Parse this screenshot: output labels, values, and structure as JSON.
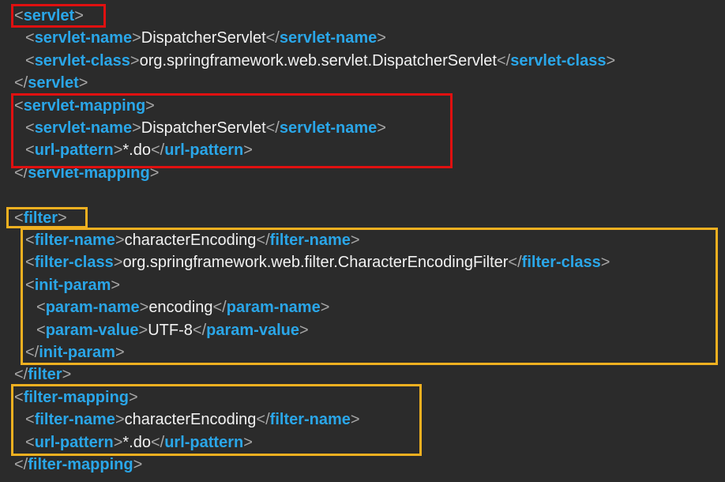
{
  "editor": {
    "colors": {
      "background": "#2b2b2b",
      "tag": "#2aa6e8",
      "bracket": "#a8a8a8",
      "text": "#f2f2f2",
      "highlight_red": "#e01010",
      "highlight_orange": "#f0b020"
    },
    "lines": [
      {
        "indent": 0,
        "tokens": [
          {
            "t": "b",
            "v": "<"
          },
          {
            "t": "g",
            "v": "servlet"
          },
          {
            "t": "b",
            "v": ">"
          }
        ]
      },
      {
        "indent": 1,
        "tokens": [
          {
            "t": "b",
            "v": "<"
          },
          {
            "t": "g",
            "v": "servlet-name"
          },
          {
            "t": "b",
            "v": ">"
          },
          {
            "t": "x",
            "v": "DispatcherServlet"
          },
          {
            "t": "b",
            "v": "</"
          },
          {
            "t": "g",
            "v": "servlet-name"
          },
          {
            "t": "b",
            "v": ">"
          }
        ]
      },
      {
        "indent": 1,
        "tokens": [
          {
            "t": "b",
            "v": "<"
          },
          {
            "t": "g",
            "v": "servlet-class"
          },
          {
            "t": "b",
            "v": ">"
          },
          {
            "t": "x",
            "v": "org.springframework.web.servlet.DispatcherServlet"
          },
          {
            "t": "b",
            "v": "</"
          },
          {
            "t": "g",
            "v": "servlet-class"
          },
          {
            "t": "b",
            "v": ">"
          }
        ]
      },
      {
        "indent": 0,
        "tokens": [
          {
            "t": "b",
            "v": "</"
          },
          {
            "t": "g",
            "v": "servlet"
          },
          {
            "t": "b",
            "v": ">"
          }
        ]
      },
      {
        "indent": 0,
        "tokens": [
          {
            "t": "b",
            "v": "<"
          },
          {
            "t": "g",
            "v": "servlet-mapping"
          },
          {
            "t": "b",
            "v": ">"
          }
        ]
      },
      {
        "indent": 1,
        "tokens": [
          {
            "t": "b",
            "v": "<"
          },
          {
            "t": "g",
            "v": "servlet-name"
          },
          {
            "t": "b",
            "v": ">"
          },
          {
            "t": "x",
            "v": "DispatcherServlet"
          },
          {
            "t": "b",
            "v": "</"
          },
          {
            "t": "g",
            "v": "servlet-name"
          },
          {
            "t": "b",
            "v": ">"
          }
        ]
      },
      {
        "indent": 1,
        "tokens": [
          {
            "t": "b",
            "v": "<"
          },
          {
            "t": "g",
            "v": "url-pattern"
          },
          {
            "t": "b",
            "v": ">"
          },
          {
            "t": "x",
            "v": "*.do"
          },
          {
            "t": "b",
            "v": "</"
          },
          {
            "t": "g",
            "v": "url-pattern"
          },
          {
            "t": "b",
            "v": ">"
          }
        ]
      },
      {
        "indent": 0,
        "tokens": [
          {
            "t": "b",
            "v": "</"
          },
          {
            "t": "g",
            "v": "servlet-mapping"
          },
          {
            "t": "b",
            "v": ">"
          }
        ]
      },
      {
        "indent": 0,
        "tokens": []
      },
      {
        "indent": 0,
        "tokens": [
          {
            "t": "b",
            "v": "<"
          },
          {
            "t": "g",
            "v": "filter"
          },
          {
            "t": "b",
            "v": ">"
          }
        ]
      },
      {
        "indent": 1,
        "tokens": [
          {
            "t": "b",
            "v": "<"
          },
          {
            "t": "g",
            "v": "filter-name"
          },
          {
            "t": "b",
            "v": ">"
          },
          {
            "t": "x",
            "v": "characterEncoding"
          },
          {
            "t": "b",
            "v": "</"
          },
          {
            "t": "g",
            "v": "filter-name"
          },
          {
            "t": "b",
            "v": ">"
          }
        ]
      },
      {
        "indent": 1,
        "tokens": [
          {
            "t": "b",
            "v": "<"
          },
          {
            "t": "g",
            "v": "filter-class"
          },
          {
            "t": "b",
            "v": ">"
          },
          {
            "t": "x",
            "v": "org.springframework.web.filter.CharacterEncodingFilter"
          },
          {
            "t": "b",
            "v": "</"
          },
          {
            "t": "g",
            "v": "filter-class"
          },
          {
            "t": "b",
            "v": ">"
          }
        ]
      },
      {
        "indent": 1,
        "tokens": [
          {
            "t": "b",
            "v": "<"
          },
          {
            "t": "g",
            "v": "init-param"
          },
          {
            "t": "b",
            "v": ">"
          }
        ]
      },
      {
        "indent": 2,
        "tokens": [
          {
            "t": "b",
            "v": "<"
          },
          {
            "t": "g",
            "v": "param-name"
          },
          {
            "t": "b",
            "v": ">"
          },
          {
            "t": "x",
            "v": "encoding"
          },
          {
            "t": "b",
            "v": "</"
          },
          {
            "t": "g",
            "v": "param-name"
          },
          {
            "t": "b",
            "v": ">"
          }
        ]
      },
      {
        "indent": 2,
        "tokens": [
          {
            "t": "b",
            "v": "<"
          },
          {
            "t": "g",
            "v": "param-value"
          },
          {
            "t": "b",
            "v": ">"
          },
          {
            "t": "x",
            "v": "UTF-8"
          },
          {
            "t": "b",
            "v": "</"
          },
          {
            "t": "g",
            "v": "param-value"
          },
          {
            "t": "b",
            "v": ">"
          }
        ]
      },
      {
        "indent": 1,
        "tokens": [
          {
            "t": "b",
            "v": "</"
          },
          {
            "t": "g",
            "v": "init-param"
          },
          {
            "t": "b",
            "v": ">"
          }
        ]
      },
      {
        "indent": 0,
        "tokens": [
          {
            "t": "b",
            "v": "</"
          },
          {
            "t": "g",
            "v": "filter"
          },
          {
            "t": "b",
            "v": ">"
          }
        ]
      },
      {
        "indent": 0,
        "tokens": [
          {
            "t": "b",
            "v": "<"
          },
          {
            "t": "g",
            "v": "filter-mapping"
          },
          {
            "t": "b",
            "v": ">"
          }
        ]
      },
      {
        "indent": 1,
        "tokens": [
          {
            "t": "b",
            "v": "<"
          },
          {
            "t": "g",
            "v": "filter-name"
          },
          {
            "t": "b",
            "v": ">"
          },
          {
            "t": "x",
            "v": "characterEncoding"
          },
          {
            "t": "b",
            "v": "</"
          },
          {
            "t": "g",
            "v": "filter-name"
          },
          {
            "t": "b",
            "v": ">"
          }
        ]
      },
      {
        "indent": 1,
        "tokens": [
          {
            "t": "b",
            "v": "<"
          },
          {
            "t": "g",
            "v": "url-pattern"
          },
          {
            "t": "b",
            "v": ">"
          },
          {
            "t": "x",
            "v": "*.do"
          },
          {
            "t": "b",
            "v": "</"
          },
          {
            "t": "g",
            "v": "url-pattern"
          },
          {
            "t": "b",
            "v": ">"
          }
        ]
      },
      {
        "indent": 0,
        "tokens": [
          {
            "t": "b",
            "v": "</"
          },
          {
            "t": "g",
            "v": "filter-mapping"
          },
          {
            "t": "b",
            "v": ">"
          }
        ]
      }
    ]
  }
}
